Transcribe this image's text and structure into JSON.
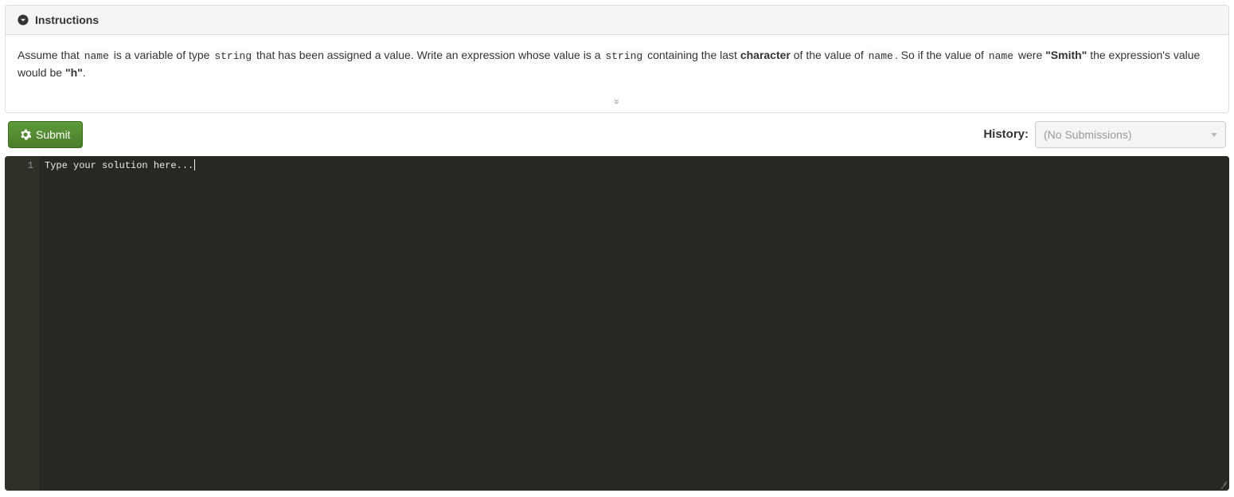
{
  "instructions": {
    "header_title": "Instructions",
    "segments": [
      {
        "t": "text",
        "v": "Assume that "
      },
      {
        "t": "code",
        "v": "name"
      },
      {
        "t": "text",
        "v": " is a variable of type "
      },
      {
        "t": "code",
        "v": "string"
      },
      {
        "t": "text",
        "v": " that has been assigned a value. Write an expression whose value is a "
      },
      {
        "t": "code",
        "v": "string"
      },
      {
        "t": "text",
        "v": " containing the last "
      },
      {
        "t": "strong",
        "v": "character"
      },
      {
        "t": "text",
        "v": " of the value of "
      },
      {
        "t": "code",
        "v": "name"
      },
      {
        "t": "text",
        "v": ". So if the value of "
      },
      {
        "t": "code",
        "v": "name"
      },
      {
        "t": "text",
        "v": " were "
      },
      {
        "t": "strong",
        "v": "\"Smith\""
      },
      {
        "t": "text",
        "v": " the expression's value would be "
      },
      {
        "t": "strong",
        "v": "\"h\""
      },
      {
        "t": "text",
        "v": "."
      }
    ],
    "expander_glyph": "»"
  },
  "toolbar": {
    "submit_label": "Submit",
    "history_label": "History:",
    "history_selected": "(No Submissions)"
  },
  "editor": {
    "line_number": "1",
    "placeholder": "Type your solution here..."
  }
}
